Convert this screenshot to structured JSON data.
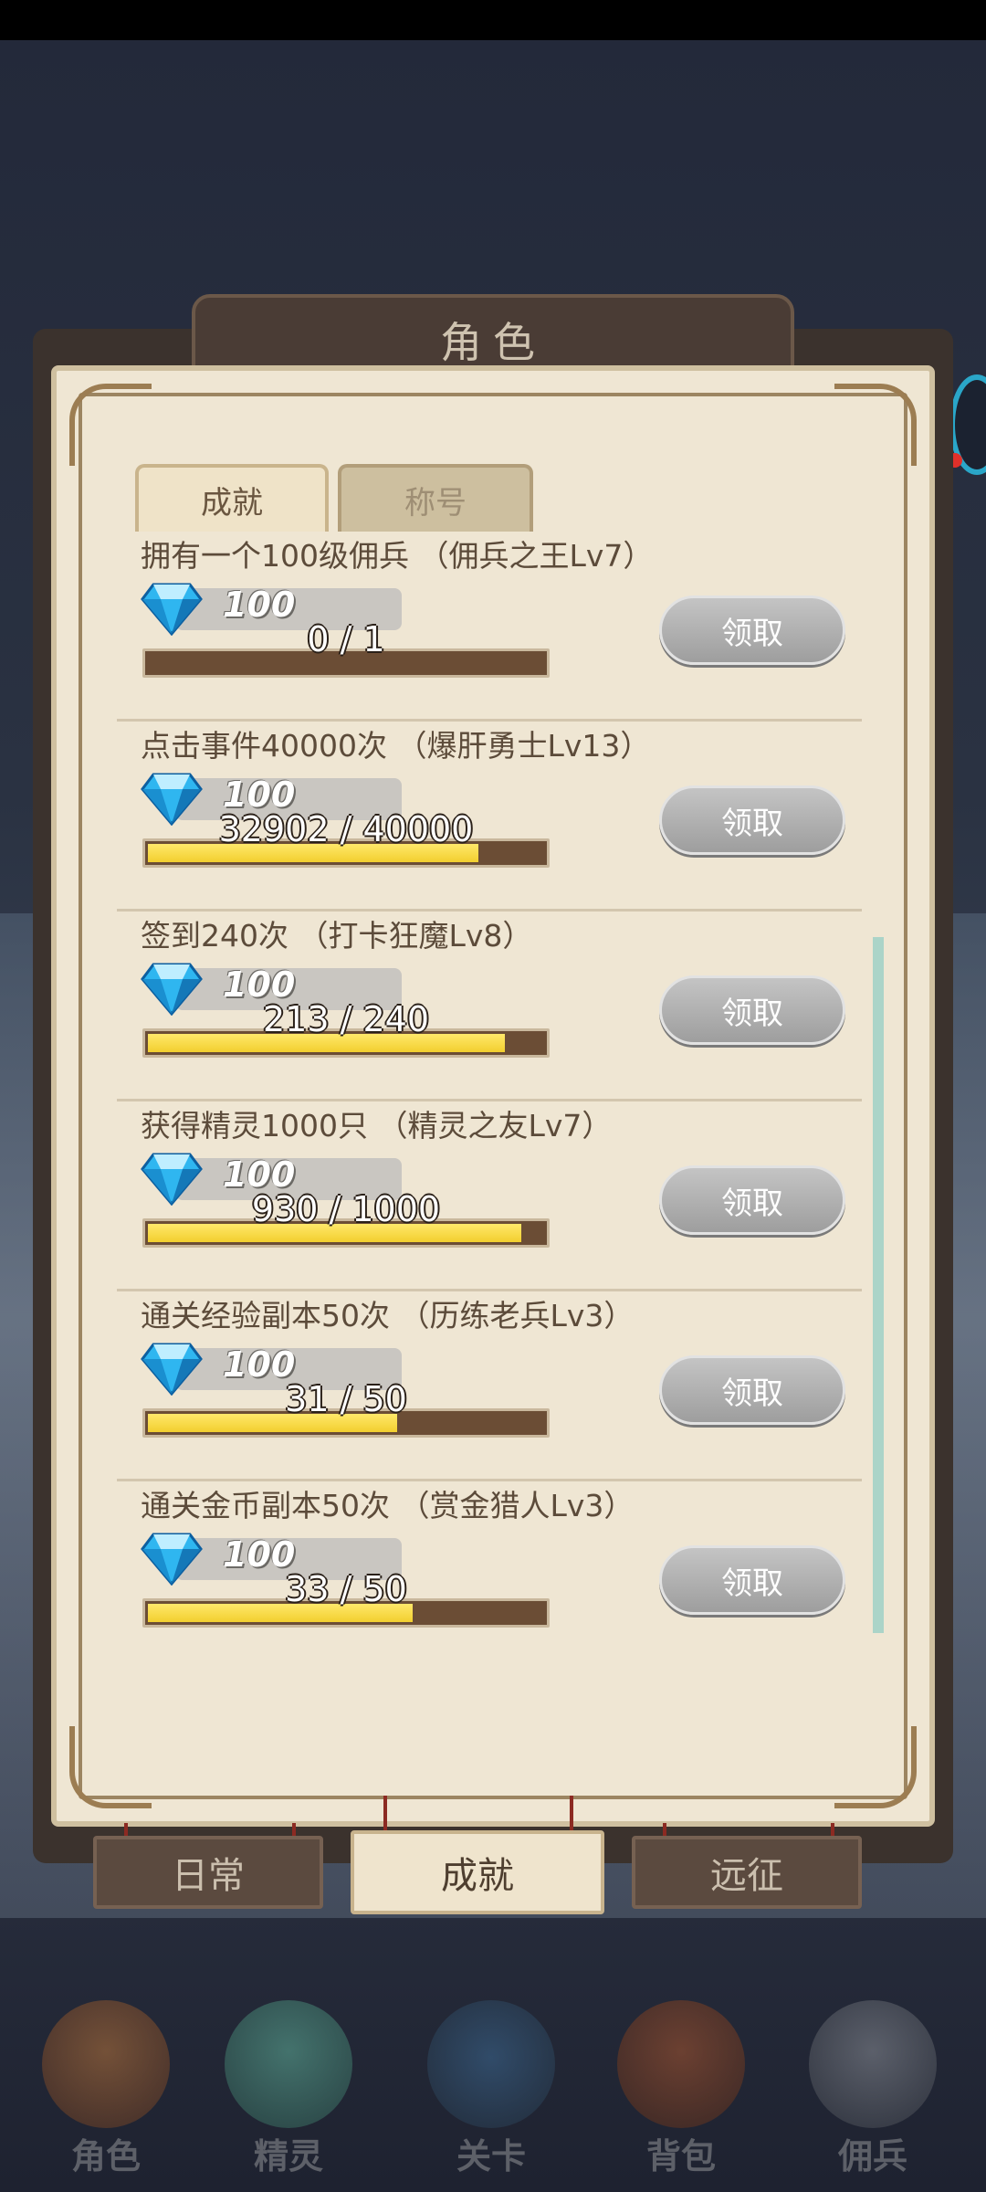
{
  "title": "角色",
  "tabs": [
    {
      "label": "成就",
      "active": true
    },
    {
      "label": "称号",
      "active": false
    }
  ],
  "achievements": [
    {
      "title": "拥有一个100级佣兵 （佣兵之王Lv7）",
      "reward": "100",
      "progress_text": "0 / 1",
      "progress": 0.0,
      "button": "领取"
    },
    {
      "title": "点击事件40000次 （爆肝勇士Lv13）",
      "reward": "100",
      "progress_text": "32902 / 40000",
      "progress": 0.8226,
      "button": "领取"
    },
    {
      "title": "签到240次 （打卡狂魔Lv8）",
      "reward": "100",
      "progress_text": "213 / 240",
      "progress": 0.8875,
      "button": "领取"
    },
    {
      "title": "获得精灵1000只 （精灵之友Lv7）",
      "reward": "100",
      "progress_text": "930 / 1000",
      "progress": 0.93,
      "button": "领取"
    },
    {
      "title": "通关经验副本50次 （历练老兵Lv3）",
      "reward": "100",
      "progress_text": "31 / 50",
      "progress": 0.62,
      "button": "领取"
    },
    {
      "title": "通关金币副本50次 （赏金猎人Lv3）",
      "reward": "100",
      "progress_text": "33 / 50",
      "progress": 0.66,
      "button": "领取"
    }
  ],
  "bottom_tabs": [
    {
      "label": "日常",
      "active": false
    },
    {
      "label": "成就",
      "active": true
    },
    {
      "label": "远征",
      "active": false
    }
  ],
  "menu": [
    {
      "label": "角色",
      "icon": "hero-icon"
    },
    {
      "label": "精灵",
      "icon": "spirit-icon"
    },
    {
      "label": "关卡",
      "icon": "stage-icon"
    },
    {
      "label": "背包",
      "icon": "backpack-icon"
    },
    {
      "label": "佣兵",
      "icon": "mercenary-icon"
    }
  ]
}
